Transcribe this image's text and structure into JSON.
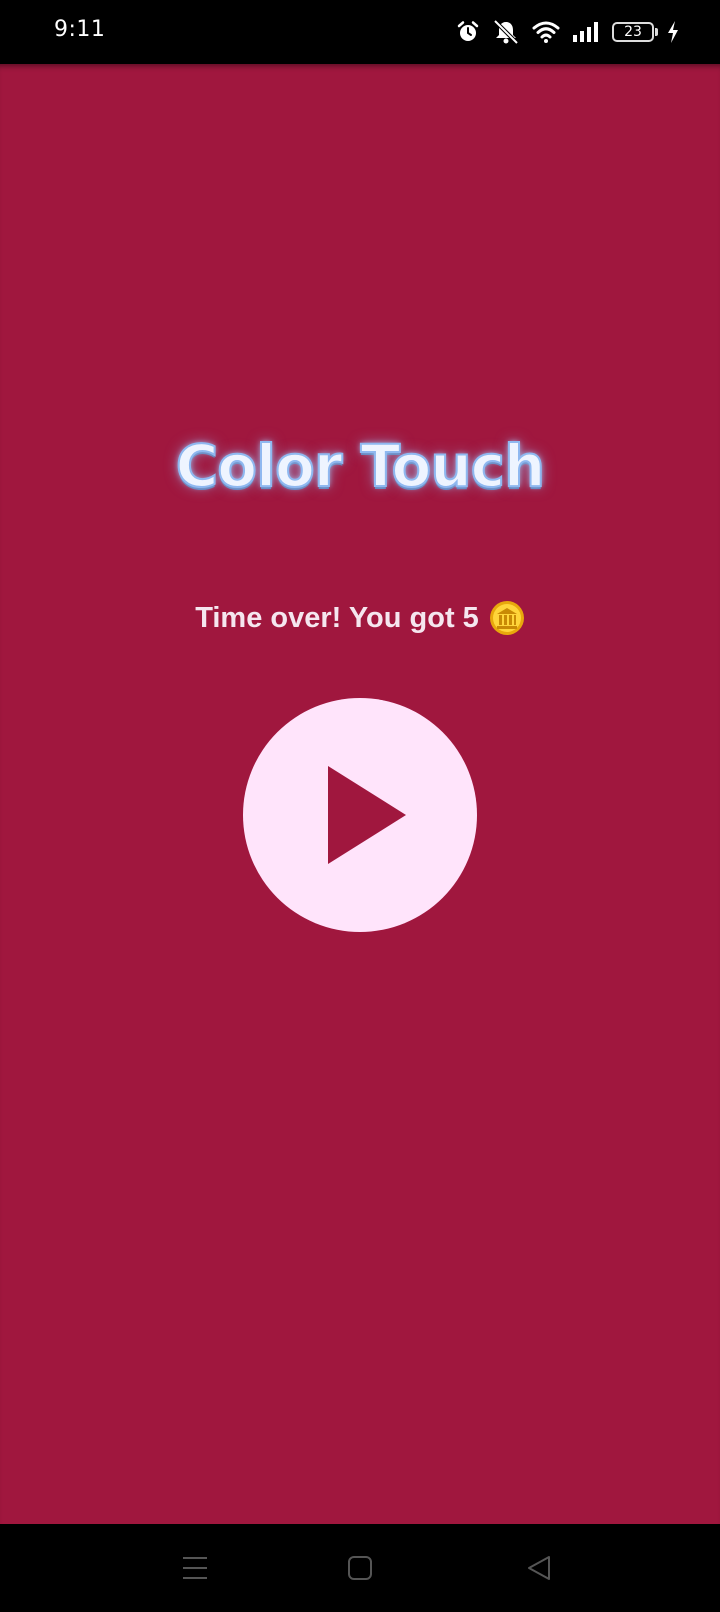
{
  "status_bar": {
    "time": "9:11",
    "battery_level": "23",
    "icons": [
      "alarm-icon",
      "notifications-off-icon",
      "wifi-icon",
      "signal-icon",
      "battery-icon",
      "charging-icon"
    ]
  },
  "app": {
    "background_color": "#a0173e",
    "title": "Color Touch",
    "result_text": "Time over! You got 5",
    "coin_icon": "coin-icon",
    "play_button_icon": "play-icon"
  },
  "nav_bar": {
    "icons": [
      "menu-icon",
      "home-icon",
      "back-icon"
    ]
  }
}
